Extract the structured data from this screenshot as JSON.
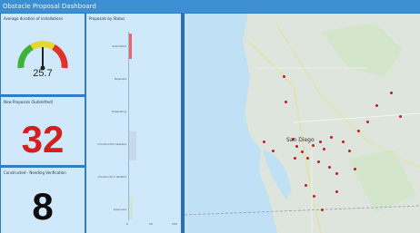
{
  "app": {
    "title": "Obstacle Proposal Dashboard"
  },
  "gauge": {
    "title": "Average duration of installations",
    "value": "25.7"
  },
  "new_proposals": {
    "title": "New Proposals (Submitted)",
    "value": "32"
  },
  "constructed": {
    "title": "Constructed - Needing Verification",
    "value": "8"
  },
  "chart_data": {
    "type": "bar",
    "title": "Proposals by Status",
    "categories": [
      "Submitted",
      "Rejected",
      "Evaluating",
      "Construction Needed",
      "Construction Verified",
      "Approved"
    ],
    "values": [
      8,
      2,
      2,
      18,
      1,
      10
    ],
    "xticks": [
      "0",
      "50",
      "100"
    ],
    "xlim": [
      0,
      100
    ],
    "highlight_index": 0
  },
  "map": {
    "label": "San Diego"
  },
  "colors": {
    "accent": "#2f7dc3",
    "alert": "#d41f1f"
  }
}
